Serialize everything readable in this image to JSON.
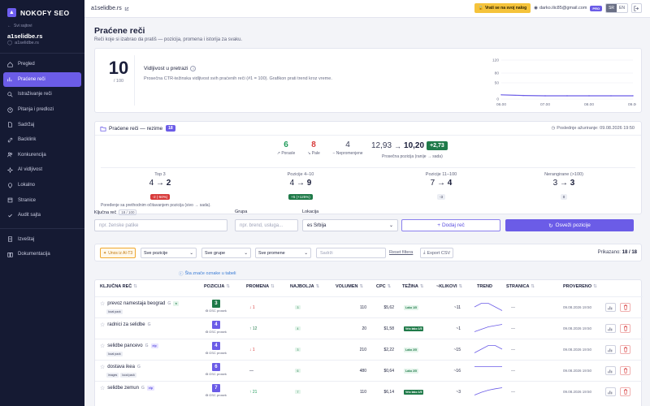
{
  "brand": {
    "name": "NOKOFY SEO"
  },
  "sidebar": {
    "back_label": "Svi sajtovi",
    "site_name": "a1selidbe.rs",
    "site_domain": "a1selidbe.rs",
    "items": [
      {
        "label": "Pregled",
        "icon": "home-icon",
        "active": false
      },
      {
        "label": "Praćene reči",
        "icon": "chart-icon",
        "active": true
      },
      {
        "label": "Istraživanje reči",
        "icon": "search-icon",
        "active": false
      },
      {
        "label": "Pitanja i predlozi",
        "icon": "question-icon",
        "active": false
      },
      {
        "label": "Sadržaj",
        "icon": "document-icon",
        "active": false
      },
      {
        "label": "Backlink",
        "icon": "link-icon",
        "active": false
      },
      {
        "label": "Konkurencija",
        "icon": "users-icon",
        "active": false
      },
      {
        "label": "AI vidljivost",
        "icon": "sparkle-icon",
        "active": false
      },
      {
        "label": "Lokalno",
        "icon": "pin-icon",
        "active": false
      },
      {
        "label": "Stranice",
        "icon": "pages-icon",
        "active": false
      },
      {
        "label": "Audit sajta",
        "icon": "audit-icon",
        "active": false
      }
    ],
    "bottom_items": [
      {
        "label": "Izveštaj",
        "icon": "report-icon"
      },
      {
        "label": "Dokumentacija",
        "icon": "book-icon"
      }
    ]
  },
  "topbar": {
    "site": "a1selidbe.rs",
    "return_button": "Vrati se na svoj nalog",
    "user_email": "darko.ilic85@gmail.com",
    "plan_badge": "PRO",
    "languages": [
      "SR",
      "EN"
    ],
    "active_language": "SR"
  },
  "page": {
    "title": "Praćene reči",
    "subtitle": "Reči koje si izabrao da pratiš — pozicija, promena i istorija za svaku."
  },
  "visibility": {
    "score": "10",
    "score_max": "/ 100",
    "title": "Vidljivost u pretrazi",
    "description": "Prosečna CTR-težinska vidljivost svih praćenih reči (#1 = 100). Grafikon prati trend kroz vreme.",
    "chart": {
      "y_ticks": [
        "120",
        "80",
        "50",
        "0"
      ],
      "x_ticks": [
        "06.00",
        "07.00",
        "08.00",
        "09.00"
      ],
      "x": [
        "06.00",
        "06.30",
        "07.00",
        "07.30",
        "08.00",
        "08.30",
        "09.00"
      ],
      "values": [
        13,
        11,
        10,
        10,
        10,
        10,
        10
      ],
      "ylim": [
        0,
        120
      ],
      "color": "#6b5ce7"
    }
  },
  "summary": {
    "title": "Praćene reči — rezime",
    "count": "18",
    "updated": "Poslednje ažuriranje: 09.08.2026 19:50",
    "rising": {
      "value": "6",
      "label": "Porasle"
    },
    "falling": {
      "value": "8",
      "label": "Pale"
    },
    "unchanged": {
      "value": "4",
      "label": "Nepromenjene"
    },
    "avg": {
      "from": "12,93",
      "to": "10,20",
      "delta": "+2,73",
      "label": "Prosečna pozicija (ranije → sada)"
    },
    "buckets": [
      {
        "title": "Top 3",
        "from": "4",
        "to": "2",
        "chip": "-2 (-50%)",
        "chip_type": "red"
      },
      {
        "title": "Pozicije 4–10",
        "from": "4",
        "to": "9",
        "chip": "+5 (+125%)",
        "chip_type": "green"
      },
      {
        "title": "Pozicije 11–100",
        "from": "7",
        "to": "4",
        "chip": "-3",
        "chip_type": "gray"
      },
      {
        "title": "Nerangirane (>100)",
        "from": "3",
        "to": "3",
        "chip": "0",
        "chip_type": "gray"
      }
    ],
    "footnote": "Poređenje sa prethodnim očitavanjem pozicija (sivo → sada)."
  },
  "form": {
    "keyword_label": "Ključna reč",
    "keyword_count": "18 / 100",
    "keyword_placeholder": "npr. ženske patike",
    "group_label": "Grupa",
    "group_placeholder": "npr. brend, usluga...",
    "location_label": "Lokacija",
    "location_value": "es Srbija",
    "add_button": "Dodaj reč",
    "refresh_button": "Osveži pozicije"
  },
  "filters": {
    "ai_chip": "Unos iz AI-T3",
    "positions": "Sve pozicije",
    "groups": "Sve grupe",
    "changes": "Sve promene",
    "search_placeholder": "Sadrži",
    "reset": "Reset filtera",
    "export": "Export CSV",
    "shown_label": "Prikazano:",
    "shown_value": "18 / 18"
  },
  "legend_link": "Šta znače oznake u tabeli",
  "table": {
    "headers": [
      "KLJUČNA REČ",
      "POZICIJA",
      "PROMENA",
      "NAJBOLJA",
      "VOLUMEN",
      "CPC",
      "TEŽINA",
      "~KLIKOVI",
      "TREND",
      "STRANICA",
      "PROVERENO"
    ],
    "rows": [
      {
        "keyword": "prevoz namestaja beograd",
        "tags": [
          "local pack"
        ],
        "star_tag": true,
        "elp": false,
        "position": "3",
        "pos_color": "#1f7a49",
        "gsc": "GSC prosek",
        "change": "↓ 1",
        "change_type": "dn",
        "best": "3",
        "volume": "110",
        "cpc": "$5,62",
        "difficulty": "Lako 1/5",
        "diff_type": "lako",
        "clicks": "~11",
        "trend": [
          3,
          2,
          2,
          3,
          4
        ],
        "page": "—",
        "checked": "09.08.2026 19:50"
      },
      {
        "keyword": "radnici za selidbe",
        "tags": [],
        "star_tag": false,
        "elp": false,
        "position": "4",
        "pos_color": "#6b5ce7",
        "gsc": "GSC prosek",
        "change": "↑ 12",
        "change_type": "nt",
        "best": "4",
        "volume": "20",
        "cpc": "$1,58",
        "difficulty": "Vrlo lako 1/5",
        "diff_type": "vl",
        "clicks": "~1",
        "trend": [
          16,
          12,
          8,
          6,
          4
        ],
        "page": "—",
        "checked": "09.08.2026 19:50"
      },
      {
        "keyword": "selidbe pancevo",
        "tags": [
          "local pack"
        ],
        "star_tag": false,
        "elp": true,
        "position": "4",
        "pos_color": "#6b5ce7",
        "gsc": "GSC prosek",
        "change": "↓ 1",
        "change_type": "dn",
        "best": "3",
        "volume": "210",
        "cpc": "$2,22",
        "difficulty": "Lako 2/5",
        "diff_type": "lako",
        "clicks": "~15",
        "trend": [
          5,
          4,
          3,
          3,
          4
        ],
        "page": "—",
        "checked": "09.08.2026 19:50"
      },
      {
        "keyword": "dostava ikea",
        "tags": [
          "images",
          "local pack"
        ],
        "star_tag": false,
        "elp": false,
        "position": "6",
        "pos_color": "#6b5ce7",
        "gsc": "GSC prosek",
        "change": "—",
        "change_type": "none",
        "best": "6",
        "volume": "480",
        "cpc": "$0,64",
        "difficulty": "Lako 2/5",
        "diff_type": "lako",
        "clicks": "~16",
        "trend": [
          6,
          6,
          6,
          6,
          6
        ],
        "page": "—",
        "checked": "09.08.2026 19:50"
      },
      {
        "keyword": "selidbe zemun",
        "tags": [],
        "star_tag": false,
        "elp": true,
        "position": "7",
        "pos_color": "#6b5ce7",
        "gsc": "GSC prosek",
        "change": "↑ 21",
        "change_type": "up",
        "best": "7",
        "volume": "110",
        "cpc": "$6,14",
        "difficulty": "Vrlo lako 1/5",
        "diff_type": "vl",
        "clicks": "~3",
        "trend": [
          28,
          20,
          14,
          10,
          7
        ],
        "page": "—",
        "checked": "09.08.2026 19:50"
      }
    ]
  }
}
